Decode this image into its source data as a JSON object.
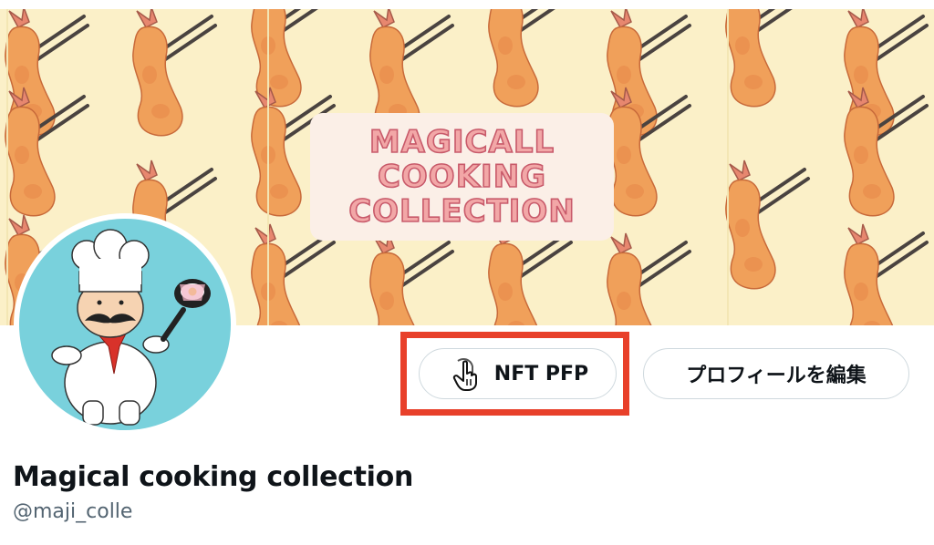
{
  "banner": {
    "title_lines": [
      "MAGICALL",
      "COOKING",
      "COLLECTION"
    ],
    "background_color": "#fbf0c8",
    "motif": "fried-shrimp-with-chopsticks"
  },
  "avatar": {
    "description_icon": "chef-character-icon",
    "background_color": "#79d1dc"
  },
  "actions": {
    "nft_pfp_label": "NFT PFP",
    "nft_pfp_icon": "hand-pointer-icon",
    "edit_profile_label": "プロフィールを編集"
  },
  "profile": {
    "display_name": "Magical cooking collection",
    "handle": "@maji_colle"
  },
  "colors": {
    "highlight": "#e8402a",
    "text_primary": "#0f1419",
    "text_secondary": "#536471",
    "border": "#cfd9de"
  }
}
